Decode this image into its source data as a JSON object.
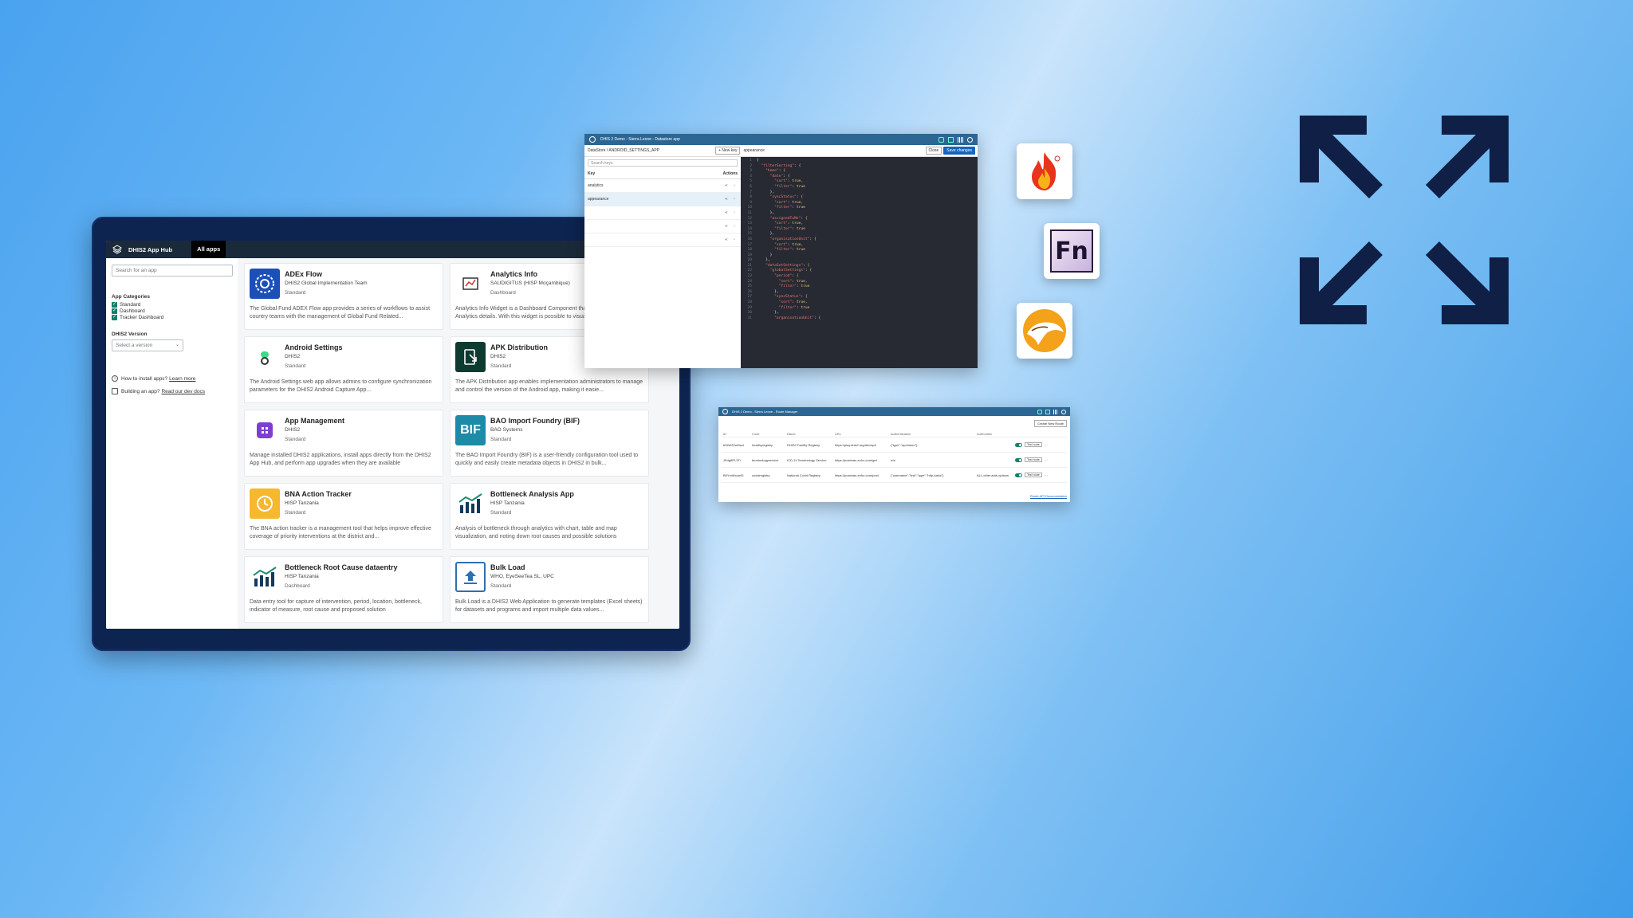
{
  "hub": {
    "brand": "DHIS2 App Hub",
    "tab": "All apps",
    "search_placeholder": "Search for an app",
    "categories_label": "App Categories",
    "categories": [
      "Standard",
      "Dashboard",
      "Tracker Dashboard"
    ],
    "version_label": "DHIS2 Version",
    "version_placeholder": "Select a version",
    "install_text": "How to install apps?",
    "install_link": "Learn more",
    "building_text": "Building an app?",
    "building_link": "Read our dev docs",
    "apps": [
      {
        "name": "ADEx Flow",
        "developer": "DHIS2 Global Implementation Team",
        "type": "Standard",
        "desc": "The Global Fund ADEX Flow app provides a series of workflows to assist country teams with the management of Global Fund Related..."
      },
      {
        "name": "Analytics Info",
        "developer": "SAUDIGITUS (HISP Moçambique)",
        "type": "Dashboard",
        "desc": "Analytics Info Widget is a Dashboard Component that allow users to view Analytics details. With this widget is possible to visualize the..."
      },
      {
        "name": "Android Settings",
        "developer": "DHIS2",
        "type": "Standard",
        "desc": "The Android Settings web app allows admins to configure synchronization parameters for the DHIS2 Android Capture App..."
      },
      {
        "name": "APK Distribution",
        "developer": "DHIS2",
        "type": "Standard",
        "desc": "The APK Distribution app enables implementation administrators to manage and control the version of the Android app, making it easie..."
      },
      {
        "name": "App Management",
        "developer": "DHIS2",
        "type": "Standard",
        "desc": "Manage installed DHIS2 applications, install apps directly from the DHIS2 App Hub, and perform app upgrades when they are available"
      },
      {
        "name": "BAO Import Foundry (BIF)",
        "developer": "BAO Systems",
        "type": "Standard",
        "desc": "The BAO Import Foundry (BIF) is a user-friendly configuration tool used to quickly and easily create metadata objects in DHIS2 in bulk..."
      },
      {
        "name": "BNA Action Tracker",
        "developer": "HISP Tanzania",
        "type": "Standard",
        "desc": "The BNA action tracker is a management tool that helps improve effective coverage of priority interventions at the district and..."
      },
      {
        "name": "Bottleneck Analysis App",
        "developer": "HISP Tanzania",
        "type": "Standard",
        "desc": "Analysis of bottleneck through analytics with chart, table and map visualization, and noting down root causes and possible solutions"
      },
      {
        "name": "Bottleneck Root Cause dataentry",
        "developer": "HISP Tanzania",
        "type": "Dashboard",
        "desc": "Data entry tool for capture of intervention, period, location, bottleneck, indicator of measure, root cause and proposed solution"
      },
      {
        "name": "Bulk Load",
        "developer": "WHO, EyeSeeTea SL, UPC",
        "type": "Standard",
        "desc": "Bulk Load is a DHIS2 Web Application to generate templates (Excel sheets) for datasets and programs and import multiple data values..."
      }
    ]
  },
  "datastore": {
    "window_title": "DHIS 2 Demo - Sierra Leone - Datastore app",
    "breadcrumb": "DataStore / ANDROID_SETTINGS_APP",
    "add_key": "+ New key",
    "current_key": "appearance",
    "close": "Close",
    "save": "Save changes",
    "search_placeholder": "Search keys",
    "col_key": "Key",
    "col_actions": "Actions",
    "rows": [
      "analytics",
      "appearance",
      "",
      "",
      ""
    ],
    "code_lines": [
      "{",
      "  \"filterSorting\": {",
      "    \"home\": {",
      "      \"date\": {",
      "        \"sort\": true,",
      "        \"filter\": true",
      "      },",
      "      \"syncStatus\": {",
      "        \"sort\": true,",
      "        \"filter\": true",
      "      },",
      "      \"assignedToMe\": {",
      "        \"sort\": true,",
      "        \"filter\": true",
      "      },",
      "      \"organisationUnit\": {",
      "        \"sort\": true,",
      "        \"filter\": true",
      "      }",
      "    },",
      "    \"dataSetSettings\": {",
      "      \"globalSettings\": {",
      "        \"period\": {",
      "          \"sort\": true,",
      "          \"filter\": true",
      "        },",
      "        \"syncStatus\": {",
      "          \"sort\": true,",
      "          \"filter\": true",
      "        },",
      "        \"organisationUnit\": {"
    ]
  },
  "routes": {
    "window_title": "DHIS 2 Demo - Sierra Leone - Route Manager",
    "new_route": "Create New Route",
    "headers": [
      "ID",
      "Code",
      "Name",
      "URL",
      "Authentication",
      "Authorities",
      ""
    ],
    "rows": [
      [
        "bHtWZZwDwd",
        "healthyregistry",
        "DHIS2 Facility Registry",
        "https://play.dhis2.org/dev/api/",
        "{\"type\":\"api-token\"}",
        "",
        "Test route"
      ],
      [
        "JEdg8PL3Ti",
        "terminologyservice",
        "ICD-11 Terminology Service",
        "https://postman-echo.com/get",
        "n/a",
        "",
        "Test route"
      ],
      [
        "B5YmWcuwSl",
        "covidregistry",
        "National Covid Registry",
        "https://postman-echo.com/post",
        "{\"username\":\"test\",\"type\":\"http-basic\"}",
        "ALL,other.auth.options",
        "Test route"
      ]
    ],
    "docs_link": "Route API Documentation"
  },
  "colors": {
    "hub_bar": "#1b2a3a",
    "frame": "#0d2450",
    "accent_green": "#147e6b",
    "window_bar": "#2c6693",
    "expand_icon": "#0f1f45"
  },
  "icons": [
    "fire-logo",
    "fn-logo",
    "camel-logo",
    "expand-arrows-icon"
  ]
}
